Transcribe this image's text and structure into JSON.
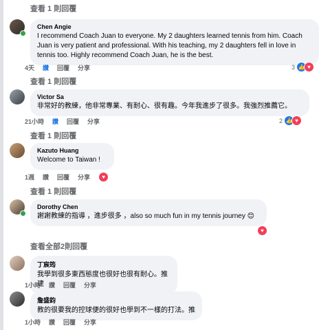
{
  "view_replies_1": "查看 1 則回覆",
  "view_replies_2": "查看 1 則回覆",
  "view_replies_3": "查看 1 則回覆",
  "view_replies_4": "查看 1 則回覆",
  "view_all_replies": "查看全部2則回覆",
  "comments": [
    {
      "author": "Chen Angie",
      "text": "I recommend Coach Juan to everyone. My 2 daughters learned tennis from him. Coach Juan is very patient and professional. With his teaching, my 2 daughters fell in love in tennis too. Highly recommend Coach Juan, he is the best.",
      "time": "4天",
      "like_label": "讚",
      "reply_label": "回覆",
      "share_label": "分享",
      "reaction_count": "3"
    },
    {
      "author": "Victor Sa",
      "text": "非常好的教練，他非常專業、有耐心、很有趣。今年我進步了很多。我強烈推薦它。",
      "time": "21小時",
      "like_label": "讚",
      "reply_label": "回覆",
      "share_label": "分享",
      "reaction_count": "2"
    },
    {
      "author": "Kazuto Huang",
      "text": "Welcome to Taiwan !",
      "time": "1週",
      "like_label": "讚",
      "reply_label": "回覆",
      "share_label": "分享"
    },
    {
      "author": "Dorothy Chen",
      "text": "謝謝教練的指導 ，進步很多 ，also so much fun in my tennis journey",
      "emoji": "😊"
    },
    {
      "author": "丁宸筠",
      "text": "我學到很多東西態度也很好也很有耐心。推建",
      "time": "1小時",
      "like_label": "讚",
      "reply_label": "回覆",
      "share_label": "分享"
    },
    {
      "author": "詹盛鈞",
      "text": "教的很要我的控球便的很好也學到不一樣的打法。推",
      "time": "1小時",
      "like_label": "讚",
      "reply_label": "回覆",
      "share_label": "分享"
    }
  ],
  "colors": {
    "bubble": "#f0f2f5",
    "accent": "#1b74e4",
    "like": "#1877f2",
    "love": "#f33e58",
    "muted": "#65676b"
  },
  "icons": [
    "like-reaction-icon",
    "love-reaction-icon",
    "online-status-icon"
  ]
}
